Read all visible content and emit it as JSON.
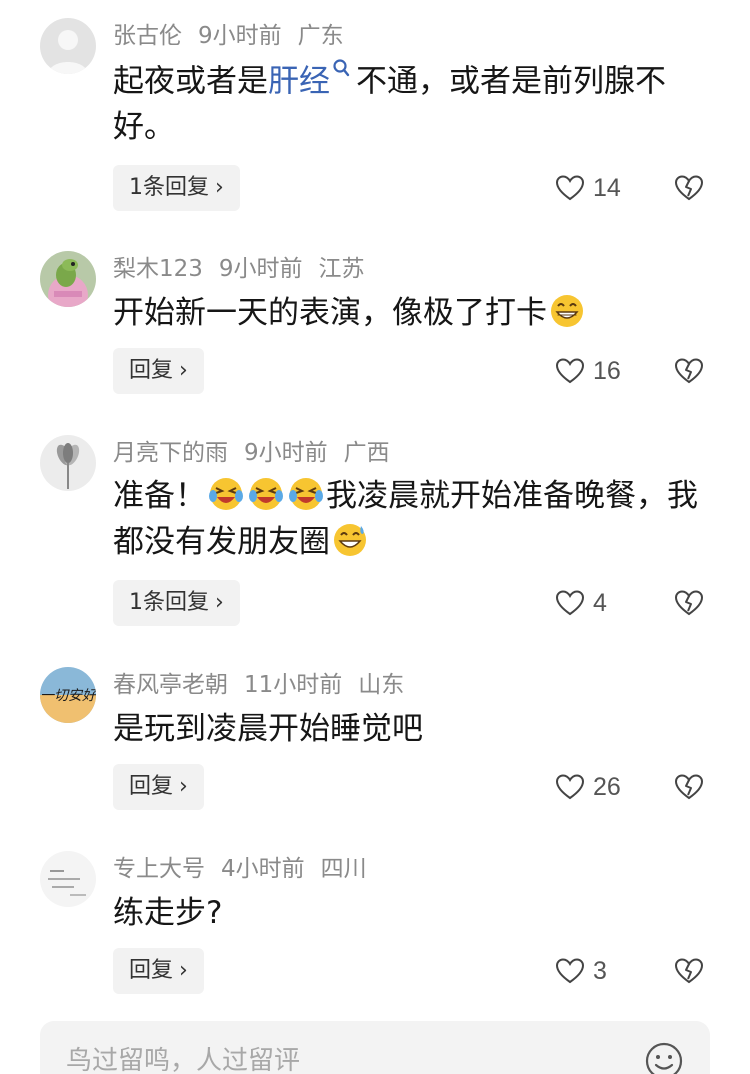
{
  "comments": [
    {
      "user": "张古伦",
      "time": "9小时前",
      "location": "广东",
      "text_before": "起夜或者是",
      "link": "肝经",
      "text_after": "不通，或者是前列腺不好。",
      "reply_label": "1条回复",
      "likes": "14"
    },
    {
      "user": "梨木123",
      "time": "9小时前",
      "location": "江苏",
      "text": "开始新一天的表演，像极了打卡",
      "reply_label": "回复",
      "likes": "16"
    },
    {
      "user": "月亮下的雨",
      "time": "9小时前",
      "location": "广西",
      "text_a": "准备！",
      "text_b": "我凌晨就开始准备晚餐，我都没有发朋友圈",
      "reply_label": "1条回复",
      "likes": "4"
    },
    {
      "user": "春风亭老朝",
      "time": "11小时前",
      "location": "山东",
      "text": "是玩到凌晨开始睡觉吧",
      "reply_label": "回复",
      "likes": "26"
    },
    {
      "user": "专上大号",
      "time": "4小时前",
      "location": "四川",
      "text": "练走步?",
      "reply_label": "回复",
      "likes": "3"
    }
  ],
  "input": {
    "placeholder": "鸟过留鸣，人过留评"
  },
  "icons": {
    "like": "heart-outline-icon",
    "dislike": "broken-heart-icon",
    "search": "search-icon",
    "emoji_picker": "smile-icon"
  },
  "colors": {
    "link": "#3a64b4",
    "meta": "#8a8a8a",
    "button_bg": "#f2f2f2",
    "input_bg": "#f3f3f3"
  }
}
